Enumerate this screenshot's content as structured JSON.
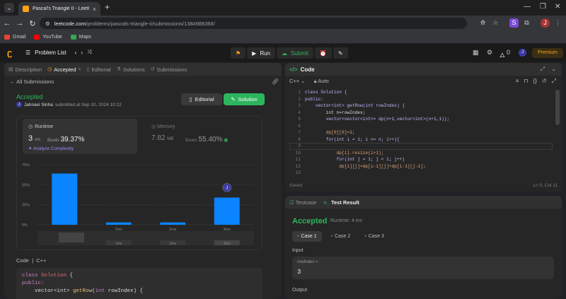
{
  "browser": {
    "tab_title": "Pascal's Triangle II - LeetCode",
    "url_site": "leetcode.com",
    "url_path": "/problems/pascals-triangle-ii/submissions/1384988368/",
    "bookmarks": [
      {
        "label": "Gmail",
        "color": "#ea4335"
      },
      {
        "label": "YouTube",
        "color": "#ff0000"
      },
      {
        "label": "Maps",
        "color": "#34a853"
      }
    ]
  },
  "header": {
    "problem_list": "Problem List",
    "run": "Run",
    "submit": "Submit",
    "streak": "0",
    "premium": "Premium",
    "avatar": "J"
  },
  "left": {
    "tabs": [
      {
        "label": "Description",
        "icon": "description-icon"
      },
      {
        "label": "Accepted",
        "icon": "clock-icon"
      },
      {
        "label": "Editorial",
        "icon": "book-icon"
      },
      {
        "label": "Solutions",
        "icon": "flask-icon"
      },
      {
        "label": "Submissions",
        "icon": "history-icon"
      }
    ],
    "all_submissions": "All Submissions",
    "status": "Accepted",
    "user": "Jahnavi Sinha",
    "submitted_at": "submitted at Sep 10, 2024 10:22",
    "editorial_btn": "Editorial",
    "solution_btn": "Solution",
    "runtime": {
      "label": "Runtime",
      "value": "3",
      "unit": "ms",
      "beats_label": "Beats",
      "beats": "39.37%",
      "analyze": "Analyze Complexity"
    },
    "memory": {
      "label": "Memory",
      "value": "7.82",
      "unit": "MB",
      "beats_label": "Beats",
      "beats": "55.40%"
    },
    "code_label": "Code",
    "lang": "C++",
    "code_lines": [
      "class Solution {",
      "public:",
      "    vector<int> getRow(int rowIndex) {",
      "        int n=rowIndex;"
    ]
  },
  "chart_data": {
    "type": "bar",
    "categories": [
      "0ms",
      "1ms",
      "2ms",
      "3ms"
    ],
    "values": [
      64,
      3,
      3,
      34
    ],
    "yticks": [
      "0%",
      "25%",
      "50%",
      "75%"
    ],
    "ylim": [
      0,
      75
    ],
    "highlight_index": 3,
    "marker_label": "J",
    "bar_color": "#0a84ff",
    "minimap_labels": [
      "1ms",
      "2ms",
      "3ms"
    ]
  },
  "code": {
    "title": "Code",
    "lang": "C++",
    "mode": "Auto",
    "lines": [
      "class Solution {",
      "public:",
      "    vector<int> getRow(int rowIndex) {",
      "        int n=rowIndex;",
      "        vector<vector<int>> dp(n+1,vector<int>(n+1,1));",
      "",
      "        dp[0][0]=1;",
      "        for(int i = 1; i <= n; i++){",
      "",
      "            dp[i].resize(i+1);",
      "            for(int j = 1; j < i; j++)",
      "             dp[i][j]=dp[i-1][j]+dp[i-1][j-1];",
      ""
    ],
    "saved": "Saved",
    "cursor": "Ln 9, Col 11"
  },
  "result": {
    "tabs": [
      "Testcase",
      "Test Result"
    ],
    "status": "Accepted",
    "runtime": "Runtime: 4 ms",
    "cases": [
      "Case 1",
      "Case 2",
      "Case 3"
    ],
    "input_label": "Input",
    "input_name": "rowIndex =",
    "input_value": "3",
    "output_label": "Output"
  }
}
